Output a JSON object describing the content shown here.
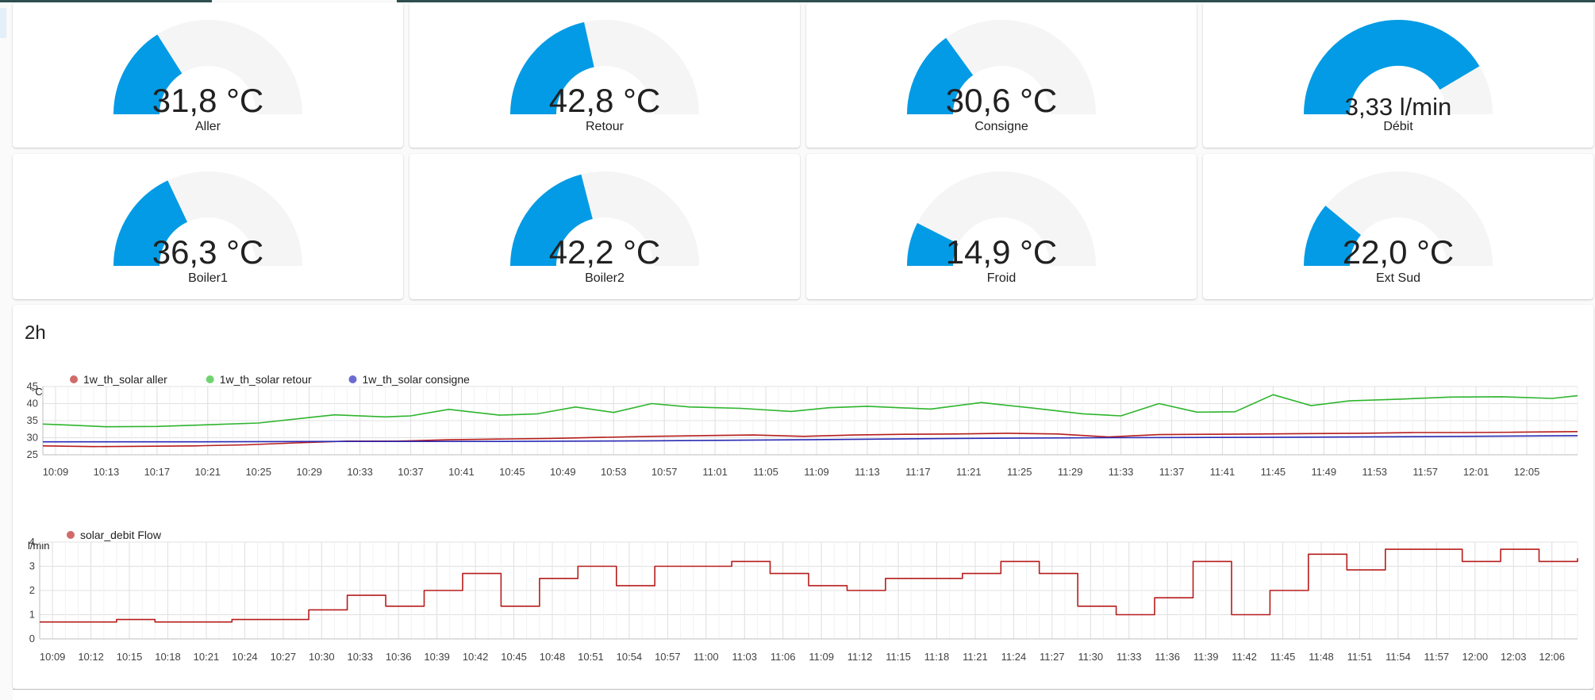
{
  "gauges": [
    {
      "name": "Aller",
      "value": "31,8 °C",
      "fraction": 0.32
    },
    {
      "name": "Retour",
      "value": "42,8 °C",
      "fraction": 0.43
    },
    {
      "name": "Consigne",
      "value": "30,6 °C",
      "fraction": 0.3
    },
    {
      "name": "Débit",
      "value": "3,33 l/min",
      "fraction": 0.83
    },
    {
      "name": "Boiler1",
      "value": "36,3 °C",
      "fraction": 0.36
    },
    {
      "name": "Boiler2",
      "value": "42,2 °C",
      "fraction": 0.42
    },
    {
      "name": "Froid",
      "value": "14,9 °C",
      "fraction": 0.15
    },
    {
      "name": "Ext Sud",
      "value": "22,0 °C",
      "fraction": 0.22
    }
  ],
  "history": {
    "title": "2h"
  },
  "colors": {
    "gauge_fill": "#039be5",
    "gauge_track": "#f5f5f5",
    "aller": "#b71c1c",
    "retour": "#2db52d",
    "consigne": "#2a2ab5",
    "legend_aller": "#d16b6b",
    "legend_retour": "#6fd46f",
    "legend_consigne": "#6b6bd1",
    "flow": "#b71c1c",
    "legend_flow": "#d16b6b"
  },
  "chart_data": [
    {
      "type": "line",
      "ylabel": "°C",
      "ylim": [
        25,
        45
      ],
      "yticks": [
        25,
        30,
        35,
        40,
        45
      ],
      "xlim": [
        "10:08",
        "12:09"
      ],
      "xticks": [
        "10:09",
        "10:13",
        "10:17",
        "10:21",
        "10:25",
        "10:29",
        "10:33",
        "10:37",
        "10:41",
        "10:45",
        "10:49",
        "10:53",
        "10:57",
        "11:01",
        "11:05",
        "11:09",
        "11:13",
        "11:17",
        "11:21",
        "11:25",
        "11:29",
        "11:33",
        "11:37",
        "11:41",
        "11:45",
        "11:49",
        "11:53",
        "11:57",
        "12:01",
        "12:05"
      ],
      "grid": true,
      "legend": "top-left",
      "series": [
        {
          "name": "1w_th_solar aller",
          "color": "#b71c1c",
          "x": [
            "10:08",
            "10:12",
            "10:16",
            "10:20",
            "10:24",
            "10:28",
            "10:32",
            "10:36",
            "10:40",
            "10:44",
            "10:48",
            "10:52",
            "10:56",
            "11:00",
            "11:04",
            "11:08",
            "11:12",
            "11:16",
            "11:20",
            "11:24",
            "11:28",
            "11:32",
            "11:36",
            "11:40",
            "11:44",
            "11:48",
            "11:52",
            "11:56",
            "12:00",
            "12:04",
            "12:09"
          ],
          "y": [
            27.6,
            27.4,
            27.5,
            27.6,
            27.9,
            28.5,
            29.0,
            29.0,
            29.4,
            29.6,
            29.8,
            30.1,
            30.4,
            30.6,
            30.8,
            30.4,
            30.8,
            31.0,
            31.1,
            31.3,
            31.1,
            30.2,
            30.9,
            31.0,
            31.1,
            31.2,
            31.3,
            31.5,
            31.5,
            31.6,
            31.8
          ]
        },
        {
          "name": "1w_th_solar retour",
          "color": "#2db52d",
          "x": [
            "10:08",
            "10:10",
            "10:13",
            "10:17",
            "10:21",
            "10:25",
            "10:29",
            "10:31",
            "10:35",
            "10:37",
            "10:40",
            "10:44",
            "10:47",
            "10:50",
            "10:53",
            "10:56",
            "10:59",
            "11:03",
            "11:07",
            "11:10",
            "11:13",
            "11:18",
            "11:22",
            "11:26",
            "11:30",
            "11:33",
            "11:36",
            "11:39",
            "11:42",
            "11:45",
            "11:48",
            "11:51",
            "11:55",
            "11:59",
            "12:03",
            "12:07",
            "12:09"
          ],
          "y": [
            34.0,
            33.7,
            33.2,
            33.3,
            33.8,
            34.3,
            35.9,
            36.7,
            36.1,
            36.4,
            38.3,
            36.6,
            37.0,
            39.0,
            37.4,
            40.0,
            39.0,
            38.6,
            37.7,
            38.8,
            39.2,
            38.4,
            40.3,
            38.7,
            37.0,
            36.4,
            40.0,
            37.5,
            37.6,
            42.6,
            39.4,
            40.8,
            41.3,
            41.9,
            42.0,
            41.5,
            42.3
          ]
        },
        {
          "name": "1w_th_solar consigne",
          "color": "#2a2ab5",
          "x": [
            "10:08",
            "10:20",
            "10:32",
            "10:44",
            "10:56",
            "11:08",
            "11:20",
            "11:32",
            "11:44",
            "11:56",
            "12:09"
          ],
          "y": [
            28.8,
            28.8,
            28.9,
            28.9,
            29.1,
            29.4,
            29.8,
            30.0,
            30.1,
            30.3,
            30.6
          ]
        }
      ]
    },
    {
      "type": "line",
      "ylabel": "l/min",
      "ylim": [
        0,
        4
      ],
      "yticks": [
        0,
        1,
        2,
        3,
        4
      ],
      "xlim": [
        "10:08",
        "12:08"
      ],
      "xticks": [
        "10:09",
        "10:12",
        "10:15",
        "10:18",
        "10:21",
        "10:24",
        "10:27",
        "10:30",
        "10:33",
        "10:36",
        "10:39",
        "10:42",
        "10:45",
        "10:48",
        "10:51",
        "10:54",
        "10:57",
        "11:00",
        "11:03",
        "11:06",
        "11:09",
        "11:12",
        "11:15",
        "11:18",
        "11:21",
        "11:24",
        "11:27",
        "11:30",
        "11:33",
        "11:36",
        "11:39",
        "11:42",
        "11:45",
        "11:48",
        "11:51",
        "11:54",
        "11:57",
        "12:00",
        "12:03",
        "12:06"
      ],
      "grid": true,
      "legend": "top-left",
      "series": [
        {
          "name": "solar_debit Flow",
          "color": "#b71c1c",
          "step": true,
          "x": [
            "10:08",
            "10:14",
            "10:17",
            "10:23",
            "10:29",
            "10:32",
            "10:35",
            "10:38",
            "10:41",
            "10:44",
            "10:47",
            "10:50",
            "10:53",
            "10:56",
            "11:02",
            "11:05",
            "11:08",
            "11:11",
            "11:14",
            "11:20",
            "11:23",
            "11:26",
            "11:29",
            "11:32",
            "11:35",
            "11:38",
            "11:41",
            "11:44",
            "11:47",
            "11:50",
            "11:53",
            "11:59",
            "12:02",
            "12:05",
            "12:08"
          ],
          "y": [
            0.7,
            0.8,
            0.7,
            0.8,
            1.2,
            1.8,
            1.35,
            2.0,
            2.7,
            1.35,
            2.5,
            3.0,
            2.2,
            3.0,
            3.2,
            2.7,
            2.2,
            2.0,
            2.5,
            2.7,
            3.2,
            2.7,
            1.35,
            1.0,
            1.7,
            3.2,
            1.0,
            2.0,
            3.5,
            2.85,
            3.7,
            3.2,
            3.7,
            3.2,
            3.33
          ]
        }
      ]
    }
  ]
}
